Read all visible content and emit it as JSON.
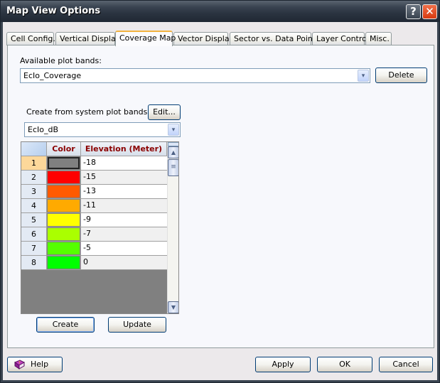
{
  "window": {
    "title": "Map View Options",
    "help_glyph": "?",
    "close_glyph": "✕"
  },
  "tabs": [
    {
      "label": "Cell Config.",
      "active": false
    },
    {
      "label": "Vertical Display",
      "active": false
    },
    {
      "label": "Coverage Map",
      "active": true
    },
    {
      "label": "Vector Display",
      "active": false
    },
    {
      "label": "Sector vs. Data Point",
      "active": false
    },
    {
      "label": "Layer Control",
      "active": false
    },
    {
      "label": "Misc.",
      "active": false
    }
  ],
  "coverage_map": {
    "available_label": "Available plot bands:",
    "available_value": "EcIo_Coverage",
    "delete_label": "Delete",
    "create_from_label": "Create from system plot bands:",
    "edit_label": "Edit...",
    "system_band_value": "EcIo_dB",
    "grid": {
      "columns": [
        "",
        "Color",
        "Elevation (Meter)"
      ],
      "rows": [
        {
          "index": "1",
          "color": "#808080",
          "elevation": "-18",
          "selected": true
        },
        {
          "index": "2",
          "color": "#ff0000",
          "elevation": "-15",
          "selected": false
        },
        {
          "index": "3",
          "color": "#ff5a00",
          "elevation": "-13",
          "selected": false
        },
        {
          "index": "4",
          "color": "#ffaa00",
          "elevation": "-11",
          "selected": false
        },
        {
          "index": "5",
          "color": "#ffff00",
          "elevation": "-9",
          "selected": false
        },
        {
          "index": "6",
          "color": "#aaff00",
          "elevation": "-7",
          "selected": false
        },
        {
          "index": "7",
          "color": "#55ff00",
          "elevation": "-5",
          "selected": false
        },
        {
          "index": "8",
          "color": "#00ff00",
          "elevation": "0",
          "selected": false
        }
      ]
    },
    "create_label": "Create",
    "update_label": "Update"
  },
  "footer": {
    "help_label": "Help",
    "apply_label": "Apply",
    "ok_label": "OK",
    "cancel_label": "Cancel"
  },
  "icons": {
    "dropdown": "▾",
    "scroll_up": "▲",
    "scroll_down": "▼",
    "scroll_grip": "≡"
  }
}
